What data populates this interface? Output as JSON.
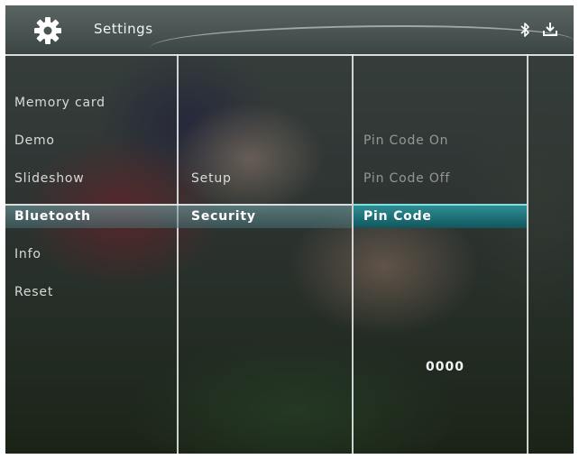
{
  "header": {
    "title": "Settings",
    "icons": [
      "gear-icon",
      "bluetooth-icon",
      "download-icon"
    ]
  },
  "columns": {
    "main": [
      {
        "label": "Memory card"
      },
      {
        "label": "Demo"
      },
      {
        "label": "Slideshow"
      },
      {
        "label": "Bluetooth"
      },
      {
        "label": "Info"
      },
      {
        "label": "Reset"
      }
    ],
    "bluetooth": [
      {
        "label": "Setup"
      },
      {
        "label": "Security"
      }
    ],
    "security": [
      {
        "label": "Pin Code On"
      },
      {
        "label": "Pin Code Off"
      },
      {
        "label": "Pin Code"
      }
    ]
  },
  "pin_code": {
    "value": "0000"
  },
  "colors": {
    "highlight": "#1b6c73",
    "highlight_border": "#7fe0e4",
    "text": "#ffffff"
  }
}
